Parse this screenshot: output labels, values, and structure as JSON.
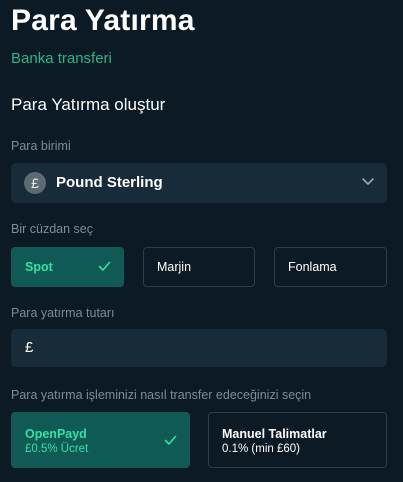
{
  "header": {
    "title": "Para Yatırma",
    "subtitle": "Banka transferi"
  },
  "form": {
    "section_title": "Para Yatırma oluştur",
    "currency": {
      "label": "Para birimi",
      "selected": "Pound Sterling",
      "icon": "pound-coin-icon",
      "symbol": "£"
    },
    "wallet": {
      "label": "Bir cüzdan seç",
      "options": [
        {
          "label": "Spot",
          "selected": true
        },
        {
          "label": "Marjin",
          "selected": false
        },
        {
          "label": "Fonlama",
          "selected": false
        }
      ]
    },
    "amount": {
      "label": "Para yatırma tutarı",
      "currency_symbol": "£",
      "value": ""
    },
    "transfer": {
      "label": "Para yatırma işleminizi nasıl transfer edeceğinizi seçin",
      "options": [
        {
          "name": "OpenPayd",
          "fee": "£0.5% Ücret",
          "selected": true
        },
        {
          "name": "Manuel Talimatlar",
          "fee": "0.1% (min £60)",
          "selected": false
        }
      ]
    }
  },
  "colors": {
    "background": "#0b1a24",
    "accent": "#21b889",
    "selected_bg": "#0f5a55",
    "field_bg": "#182b39"
  }
}
